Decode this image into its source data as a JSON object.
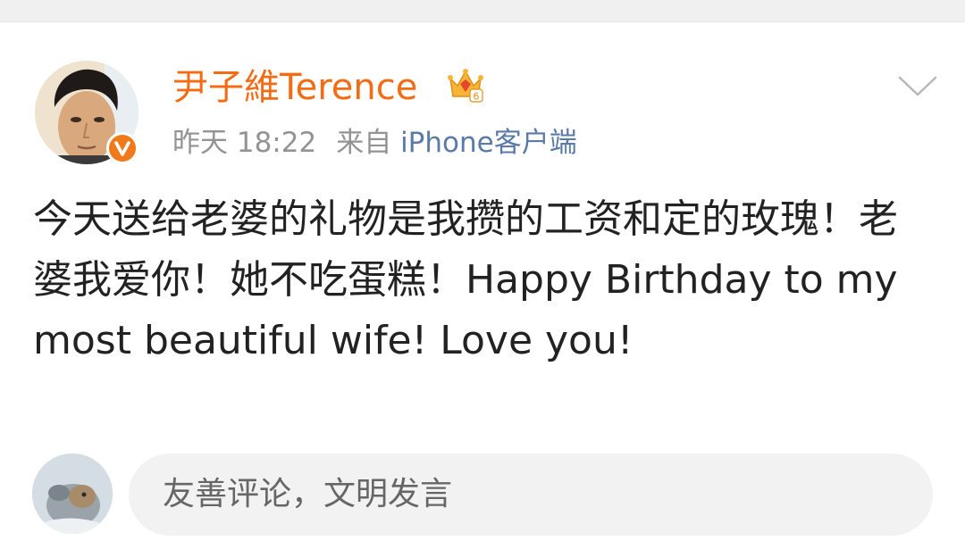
{
  "post": {
    "author": {
      "name": "尹子維Terence",
      "avatar_icon": "user-avatar-photo",
      "verified_icon": "verified-badge-icon",
      "member_icon": "crown-member-icon",
      "member_level": "6"
    },
    "meta": {
      "time": "昨天 18:22",
      "source_prefix": "来自",
      "source": "iPhone客户端"
    },
    "menu_icon": "chevron-down-icon",
    "content": "今天送给老婆的礼物是我攒的工资和定的玫瑰！老婆我爱你！她不吃蛋糕！Happy Birthday to my most beautiful wife!  Love you!"
  },
  "comment_bar": {
    "avatar_icon": "commenter-avatar",
    "placeholder": "友善评论，文明发言"
  },
  "colors": {
    "username": "#f56b14",
    "meta_gray": "#939393",
    "source_blue": "#5a7aa8",
    "verified_orange": "#f07a1a",
    "text": "#222222",
    "input_bg": "#f2f2f2"
  }
}
